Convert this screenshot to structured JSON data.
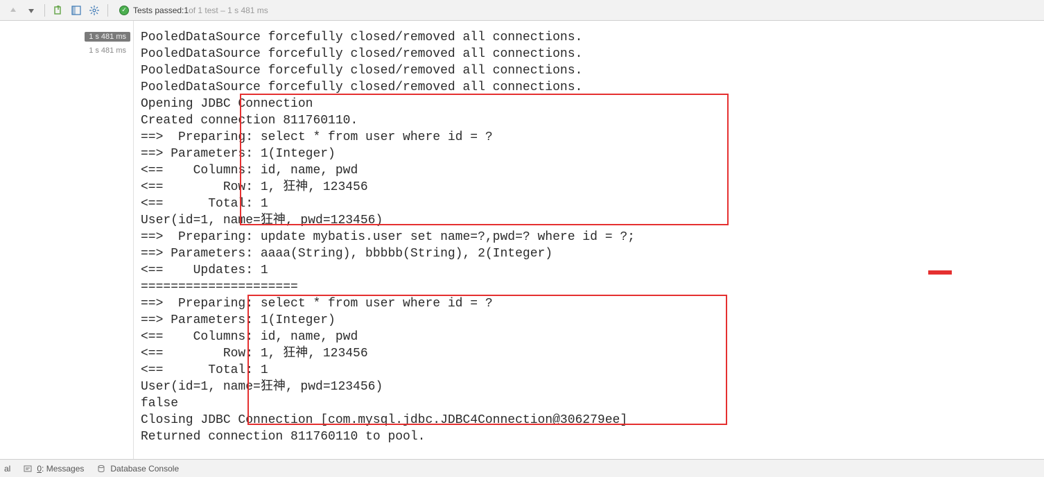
{
  "toolbar": {
    "icons": [
      "arrow-up",
      "arrow-down",
      "sep",
      "export",
      "layout",
      "gear",
      "sep2"
    ]
  },
  "status": {
    "prefix": "Tests passed: ",
    "passed": "1",
    "suffix": " of 1 test – 1 s 481 ms"
  },
  "left": {
    "chip_dark": "1 s 481 ms",
    "chip_light": "1 s 481 ms"
  },
  "console": {
    "lines": [
      "PooledDataSource forcefully closed/removed all connections.",
      "PooledDataSource forcefully closed/removed all connections.",
      "PooledDataSource forcefully closed/removed all connections.",
      "PooledDataSource forcefully closed/removed all connections.",
      "Opening JDBC Connection",
      "Created connection 811760110.",
      "==>  Preparing: select * from user where id = ?",
      "==> Parameters: 1(Integer)",
      "<==    Columns: id, name, pwd",
      "<==        Row: 1, 狂神, 123456",
      "<==      Total: 1",
      "User(id=1, name=狂神, pwd=123456)",
      "==>  Preparing: update mybatis.user set name=?,pwd=? where id = ?;",
      "==> Parameters: aaaa(String), bbbbb(String), 2(Integer)",
      "<==    Updates: 1",
      "=====================",
      "==>  Preparing: select * from user where id = ?",
      "==> Parameters: 1(Integer)",
      "<==    Columns: id, name, pwd",
      "<==        Row: 1, 狂神, 123456",
      "<==      Total: 1",
      "User(id=1, name=狂神, pwd=123456)",
      "false",
      "Closing JDBC Connection [com.mysql.jdbc.JDBC4Connection@306279ee]",
      "Returned connection 811760110 to pool."
    ]
  },
  "bottom": {
    "terminal": "al",
    "messages_underline": "0",
    "messages_rest": ": Messages",
    "db_console": "Database Console"
  }
}
